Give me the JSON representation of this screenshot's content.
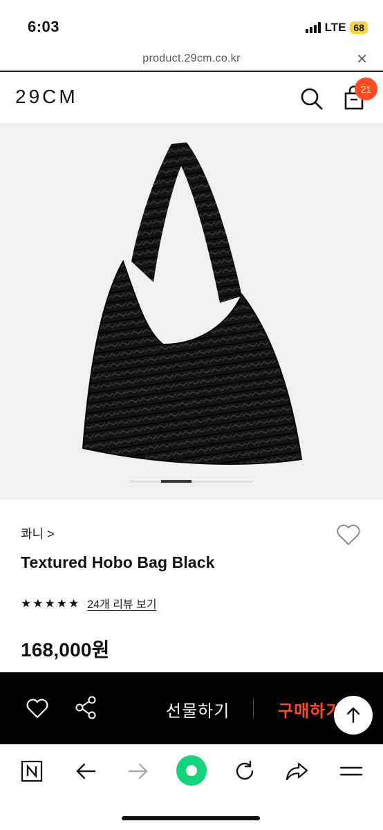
{
  "status_bar": {
    "time": "6:03",
    "network": "LTE",
    "battery": "68"
  },
  "browser": {
    "url": "product.29cm.co.kr",
    "close_icon": "close-icon"
  },
  "header": {
    "logo": "29CM",
    "search_icon": "search-icon",
    "cart_icon": "shopping-bag-icon",
    "cart_count": "21"
  },
  "product": {
    "image_alt_icon": "hobo-bag-image",
    "carousel_position": 0.3,
    "brand": "콰니 >",
    "title": "Textured Hobo Bag Black",
    "rating": 5,
    "rating_max": 5,
    "review_link": "24개 리뷰 보기",
    "price": "168,000원"
  },
  "action_bar": {
    "wishlist_icon": "heart-outline-icon",
    "share_icon": "share-icon",
    "gift_label": "선물하기",
    "buy_label": "구매하기",
    "scroll_top_icon": "arrow-up-icon"
  },
  "browser_toolbar": {
    "items": [
      "naver-icon",
      "back-arrow-icon",
      "forward-arrow-icon",
      "home-dot-icon",
      "refresh-icon",
      "share-arrow-icon",
      "menu-icon"
    ]
  },
  "colors": {
    "accent": "#ff4b1f",
    "green": "#13d47c",
    "action_bar_bg": "#000000",
    "image_bg": "#f0f0f0"
  }
}
